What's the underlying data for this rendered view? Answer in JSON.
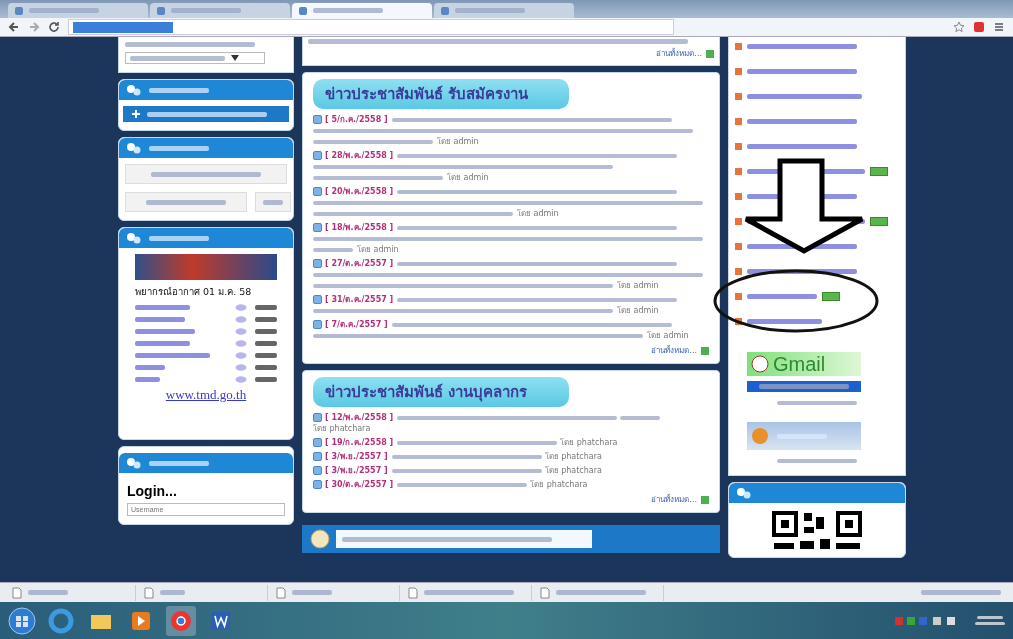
{
  "browser": {
    "tabs": [
      {
        "selected": false
      },
      {
        "selected": false
      },
      {
        "selected": true
      },
      {
        "selected": false
      }
    ]
  },
  "weather": {
    "title": "พยากรณ์อากาศ 01 ม.ค. 58",
    "link": "www.tmd.go.th"
  },
  "login": {
    "title": "Login...",
    "placeholder": "Username"
  },
  "top_more": "อ่านทั้งหมด...",
  "news": [
    {
      "heading": "ข่าวประชาสัมพันธ์ รับสมัครงาน",
      "more": "อ่านทั้งหมด...",
      "items": [
        {
          "date": "[ 5/ก.ค./2558 ]",
          "author": "โดย admin"
        },
        {
          "date": "[ 28/พ.ค./2558 ]",
          "author": "โดย admin"
        },
        {
          "date": "[ 20/พ.ค./2558 ]",
          "author": "โดย admin"
        },
        {
          "date": "[ 18/พ.ค./2558 ]",
          "author": "โดย admin"
        },
        {
          "date": "[ 27/ต.ค./2557 ]",
          "author": "โดย admin"
        },
        {
          "date": "[ 31/ต.ค./2557 ]",
          "author": "โดย admin"
        },
        {
          "date": "[ 7/ต.ค./2557 ]",
          "author": "โดย admin"
        }
      ]
    },
    {
      "heading": "ข่าวประชาสัมพันธ์ งานบุคลากร",
      "more": "อ่านทั้งหมด...",
      "items": [
        {
          "date": "[ 12/พ.ค./2558 ]",
          "author": "โดย phatchara"
        },
        {
          "date": "[ 19/ก.ค./2558 ]",
          "author": "โดย phatchara"
        },
        {
          "date": "[ 3/พ.ย./2557 ]",
          "author": "โดย phatchara"
        },
        {
          "date": "[ 3/พ.ย./2557 ]",
          "author": "โดย phatchara"
        },
        {
          "date": "[ 30/ต.ค./2557 ]",
          "author": "โดย phatchara"
        }
      ]
    }
  ],
  "right_links": [
    {
      "new": false
    },
    {
      "new": false
    },
    {
      "new": false
    },
    {
      "new": false
    },
    {
      "new": false
    },
    {
      "new": true
    },
    {
      "new": false
    },
    {
      "new": true
    },
    {
      "new": false
    },
    {
      "new": false
    },
    {
      "new": true
    },
    {
      "new": false
    }
  ],
  "gmail": {
    "logo": "Gmail"
  }
}
